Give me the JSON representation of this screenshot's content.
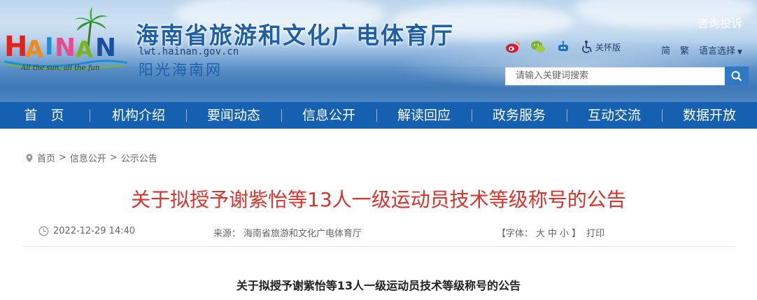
{
  "header": {
    "logo_text": "HAINAN",
    "logo_tagline": "All the sun, all the fun",
    "site_name": "海南省旅游和文化广电体育厅",
    "site_url": "lwt.hainan.gov.cn",
    "site_sub": "阳光海南网",
    "consult_label": "咨询投诉",
    "care_label": "关怀版",
    "lang_simplified": "简",
    "lang_traditional": "繁",
    "lang_select": "语言选择",
    "search_placeholder": "请输入关键词搜索",
    "social_icons": [
      "weibo-icon",
      "wechat-icon",
      "robot-icon",
      "accessibility-icon"
    ]
  },
  "nav": {
    "items": [
      "首　页",
      "机构介绍",
      "要闻动态",
      "信息公开",
      "解读回应",
      "政务服务",
      "互动交流",
      "数据开放"
    ]
  },
  "breadcrumb": {
    "items": [
      "首页",
      "信息公开",
      "公示公告"
    ],
    "separator": ">"
  },
  "article": {
    "title": "关于拟授予谢紫怡等13人一级运动员技术等级称号的公告",
    "date": "2022-12-29 14:40",
    "source_label": "来源：",
    "source": "海南省旅游和文化广电体育厅",
    "font_label": "【字体：",
    "font_large": "大",
    "font_medium": "中",
    "font_small": "小",
    "font_close": "】",
    "print_label": "打印",
    "body_title": "关于拟授予谢紫怡等13人一级运动员技术等级称号的公告"
  },
  "colors": {
    "nav_bg": "#1560b1",
    "title_red": "#d8332d",
    "brand_blue": "#1f5fa8"
  }
}
